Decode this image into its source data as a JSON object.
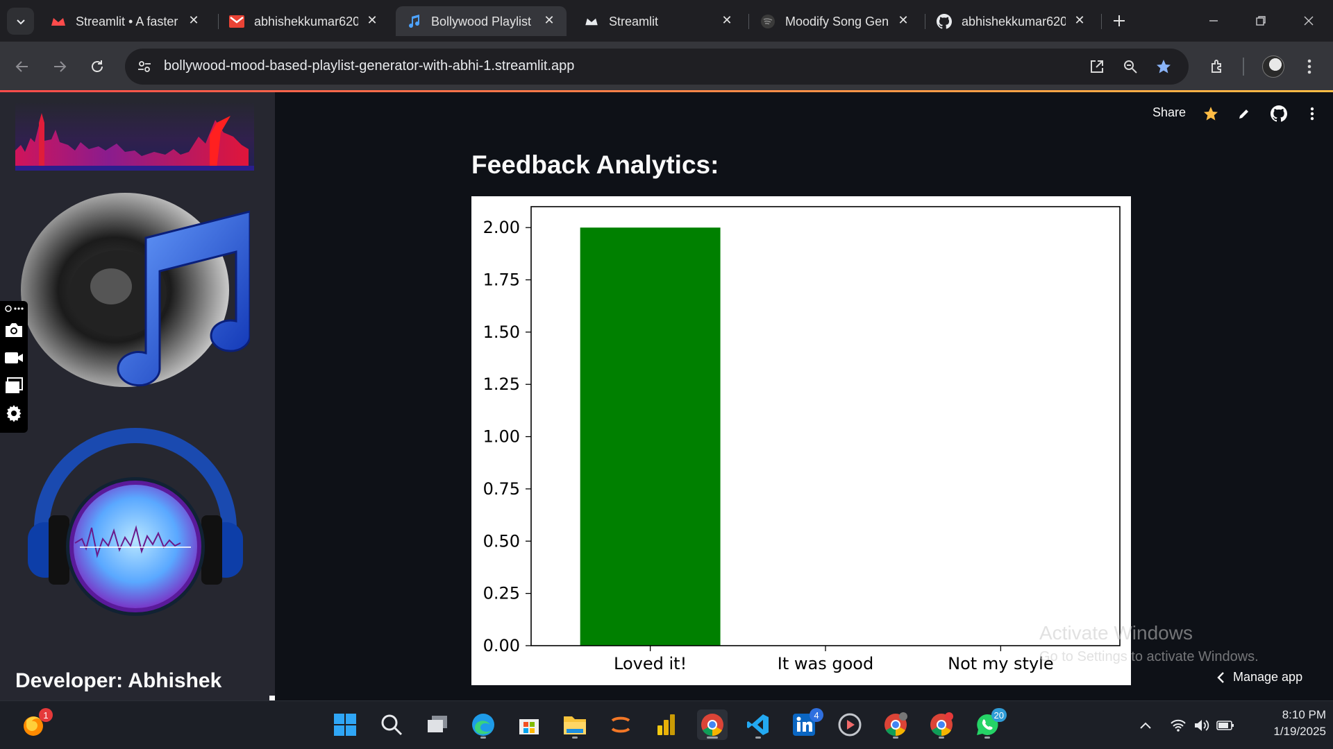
{
  "browser": {
    "tabs": [
      {
        "title": "Streamlit • A faster",
        "favicon": "streamlit-crown-icon",
        "active": false
      },
      {
        "title": "abhishekkumar620",
        "favicon": "gmail-icon",
        "active": false
      },
      {
        "title": "Bollywood Playlist",
        "favicon": "music-note-icon",
        "active": true
      },
      {
        "title": "Streamlit",
        "favicon": "streamlit-crown-icon",
        "active": false
      },
      {
        "title": "Moodify Song Gen",
        "favicon": "spotify-icon",
        "active": false
      },
      {
        "title": "abhishekkumar620",
        "favicon": "github-icon",
        "active": false
      }
    ],
    "url": "bollywood-mood-based-playlist-generator-with-abhi-1.streamlit.app"
  },
  "app": {
    "header": {
      "share_label": "Share"
    },
    "heading": "Feedback Analytics:",
    "sidebar": {
      "developer_label": "Developer: Abhishek"
    },
    "manage_app_label": "Manage app"
  },
  "chart_data": {
    "type": "bar",
    "categories": [
      "Loved it!",
      "It was good",
      "Not my style"
    ],
    "values": [
      2,
      0,
      0
    ],
    "colors": [
      "#008000",
      "#008000",
      "#008000"
    ],
    "ylim": [
      0,
      2.1
    ],
    "yticks": [
      "0.00",
      "0.25",
      "0.50",
      "0.75",
      "1.00",
      "1.25",
      "1.50",
      "1.75",
      "2.00"
    ],
    "title": "",
    "xlabel": "",
    "ylabel": ""
  },
  "watermark": {
    "line1": "Activate Windows",
    "line2": "Go to Settings to activate Windows."
  },
  "taskbar": {
    "apps": [
      "firefox-icon",
      "windows-start-icon",
      "search-icon",
      "task-view-icon",
      "edge-icon",
      "microsoft-store-icon",
      "file-explorer-icon",
      "jupyter-icon",
      "power-bi-icon",
      "chrome-icon",
      "vscode-icon",
      "linkedin-icon",
      "media-player-icon",
      "chrome-profile-icon",
      "chrome-profile-icon",
      "whatsapp-icon"
    ],
    "badges": {
      "firefox": "1",
      "linkedin": "4",
      "whatsapp": "20"
    },
    "time": "8:10 PM",
    "date": "1/19/2025"
  }
}
